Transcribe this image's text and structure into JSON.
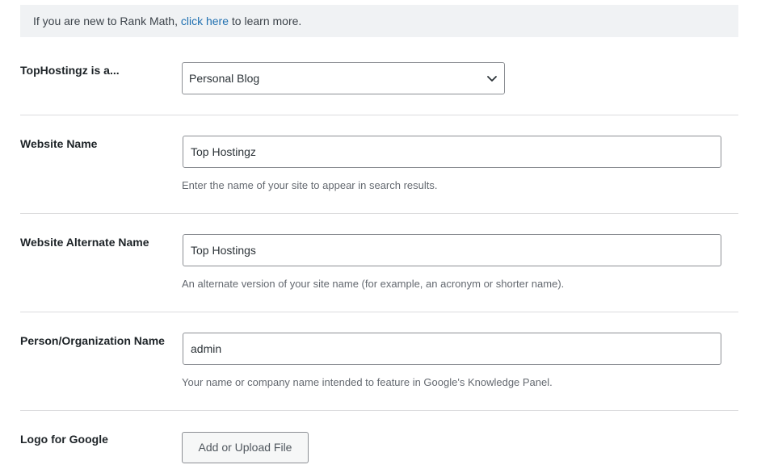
{
  "notice": {
    "prefix": "If you are new to Rank Math,",
    "link": "click here",
    "suffix": "to learn more."
  },
  "site_type": {
    "label": "TopHostingz is a...",
    "selected": "Personal Blog"
  },
  "website_name": {
    "label": "Website Name",
    "value": "Top Hostingz",
    "help": "Enter the name of your site to appear in search results."
  },
  "alternate_name": {
    "label": "Website Alternate Name",
    "value": "Top Hostings",
    "help": "An alternate version of your site name (for example, an acronym or shorter name)."
  },
  "person_org": {
    "label": "Person/Organization Name",
    "value": "admin",
    "help": "Your name or company name intended to feature in Google's Knowledge Panel."
  },
  "logo": {
    "label": "Logo for Google",
    "button": "Add or Upload File"
  }
}
